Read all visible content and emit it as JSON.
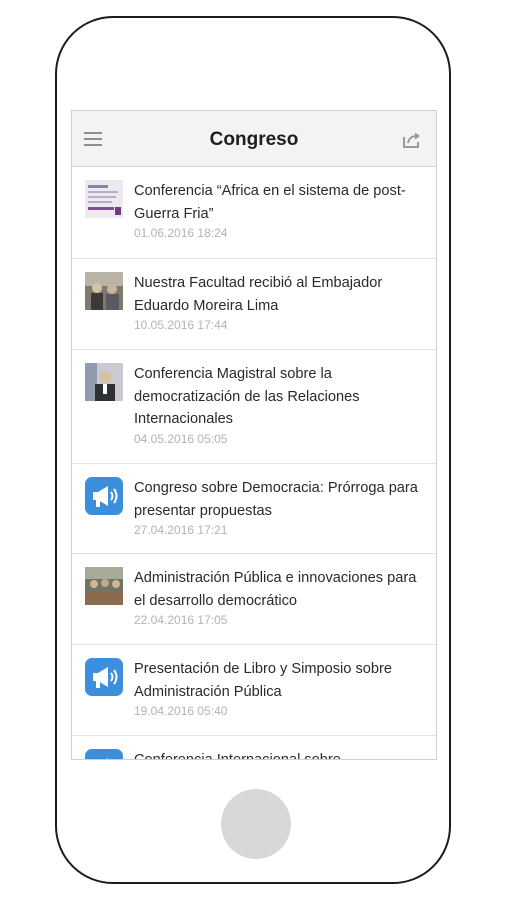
{
  "header": {
    "title": "Congreso",
    "menu_icon": "hamburger-menu-icon",
    "share_icon": "share-icon"
  },
  "items": [
    {
      "title": "Conferencia “Africa en el sistema de post-Guerra Fria”",
      "date": "01.06.2016 18:24",
      "thumb": "document-thumbnail"
    },
    {
      "title": "Nuestra Facultad recibió al Embajador Eduardo Moreira Lima",
      "date": "10.05.2016 17:44",
      "thumb": "photo-thumbnail"
    },
    {
      "title": "Conferencia Magistral sobre la democratización de las Relaciones Internacionales",
      "date": "04.05.2016 05:05",
      "thumb": "photo-thumbnail"
    },
    {
      "title": "Congreso sobre Democracia: Prórroga para presentar propuestas",
      "date": "27.04.2016 17:21",
      "thumb": "megaphone-icon"
    },
    {
      "title": "Administración Pública e innovaciones para el desarrollo democrático",
      "date": "22.04.2016 17:05",
      "thumb": "photo-thumbnail"
    },
    {
      "title": "Presentación de Libro y Simposio sobre Administración Pública",
      "date": "19.04.2016 05:40",
      "thumb": "megaphone-icon"
    },
    {
      "title": "Conferencia Internacional sobre",
      "date": "",
      "thumb": "megaphone-icon"
    }
  ],
  "colors": {
    "accent": "#3d8edc",
    "date_text": "#b3b3b3",
    "header_bg": "#f3f3f3"
  }
}
